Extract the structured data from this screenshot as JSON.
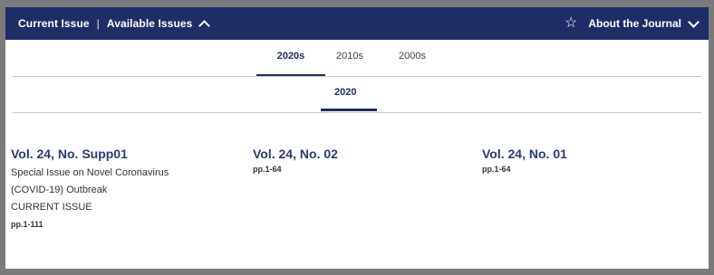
{
  "topbar": {
    "current_issue": "Current Issue",
    "separator": "|",
    "available_issues": "Available Issues",
    "about": "About the Journal"
  },
  "decade_tabs": [
    "2020s",
    "2010s",
    "2000s"
  ],
  "active_decade": "2020s",
  "active_year": "2020",
  "issues": [
    {
      "title": "Vol. 24, No. Supp01",
      "description_line1": "Special Issue on Novel Coronavirus",
      "description_line2": "(COVID-19) Outbreak",
      "status": "CURRENT ISSUE",
      "pages": "pp.1-111"
    },
    {
      "title": "Vol. 24, No. 02",
      "pages": "pp.1-64"
    },
    {
      "title": "Vol. 24, No. 01",
      "pages": "pp.1-64"
    }
  ],
  "colors": {
    "navy": "#1f2d66",
    "link": "#2b3a78"
  }
}
